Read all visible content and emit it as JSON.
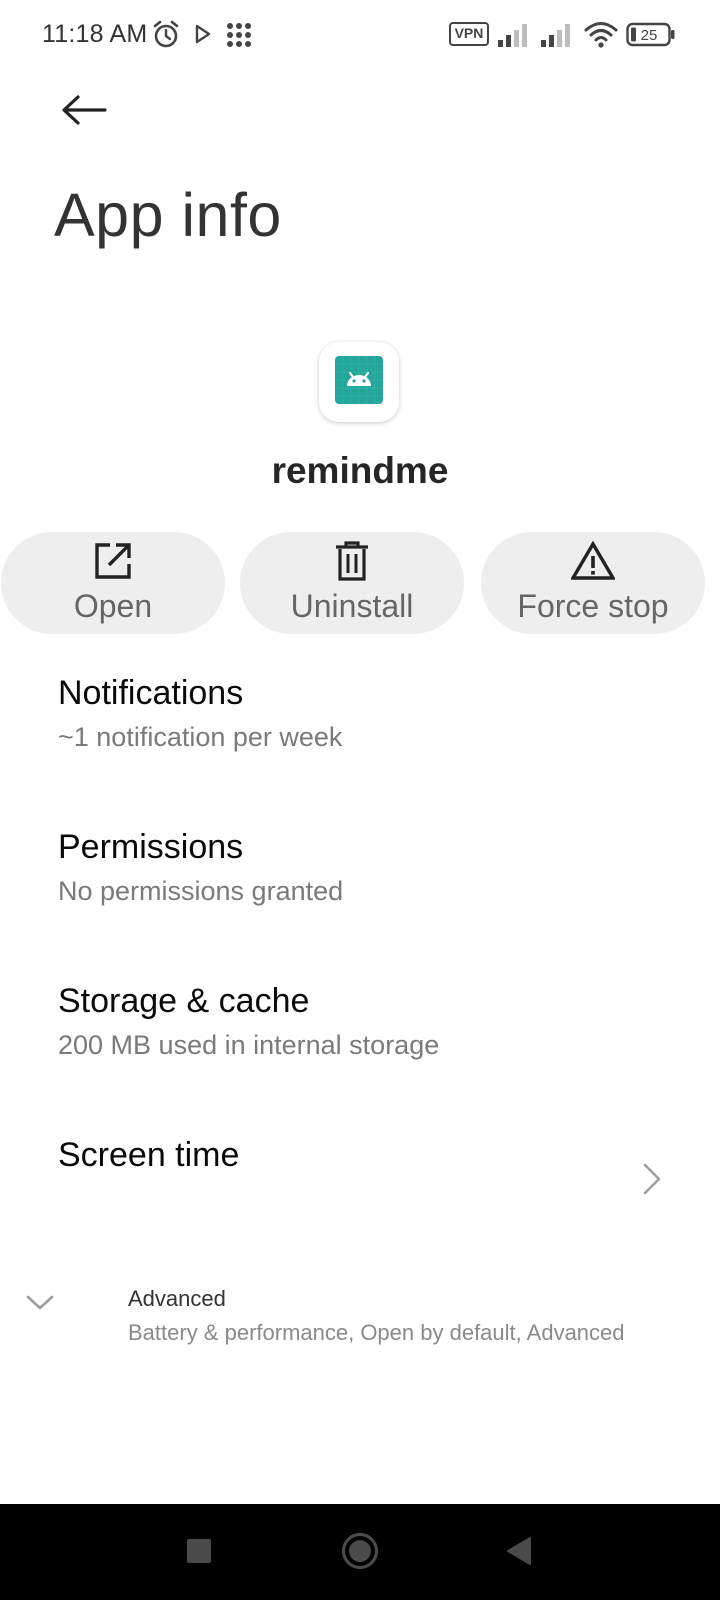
{
  "status_bar": {
    "time": "11:18 AM",
    "vpn_label": "VPN",
    "battery_level": "25",
    "icons": [
      "alarm-icon",
      "play-icon",
      "apps-grid-icon",
      "vpn-icon",
      "signal-icon",
      "signal-icon",
      "wifi-icon",
      "battery-icon"
    ]
  },
  "header": {
    "back_icon": "arrow-left-icon",
    "title": "App info"
  },
  "app": {
    "name": "remindme",
    "icon": "android-icon",
    "icon_color": "#26a69a"
  },
  "actions": [
    {
      "label": "Open",
      "icon": "open-external-icon"
    },
    {
      "label": "Uninstall",
      "icon": "trash-icon"
    },
    {
      "label": "Force stop",
      "icon": "warning-icon"
    }
  ],
  "settings": [
    {
      "title": "Notifications",
      "subtitle": "~1 notification per week"
    },
    {
      "title": "Permissions",
      "subtitle": "No permissions granted"
    },
    {
      "title": "Storage & cache",
      "subtitle": "200 MB used in internal storage"
    },
    {
      "title": "Screen time",
      "subtitle": "",
      "icon": "chevron-right-icon"
    }
  ],
  "advanced": {
    "title": "Advanced",
    "subtitle": "Battery & performance, Open by default, Advanced",
    "icon": "chevron-down-icon"
  },
  "nav_bar": {
    "buttons": [
      "recents-icon",
      "home-icon",
      "back-triangle-icon"
    ]
  }
}
